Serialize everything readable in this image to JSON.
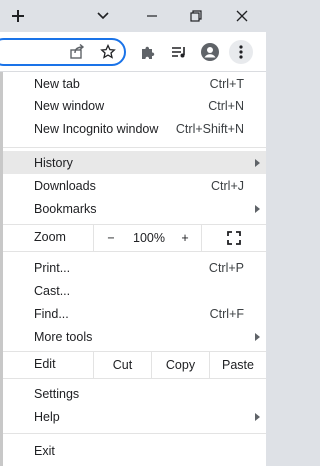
{
  "titlebar": {
    "new_tab_icon": "plus-icon",
    "tab_search_icon": "chevron-down-icon",
    "minimize_icon": "minimize-icon",
    "restore_icon": "restore-icon",
    "close_icon": "close-icon"
  },
  "toolbar": {
    "share_icon": "share-icon",
    "bookmark_icon": "star-icon",
    "extensions_icon": "puzzle-icon",
    "media_icon": "media-queue-icon",
    "profile_icon": "avatar-icon",
    "menu_icon": "kebab-menu-icon",
    "accent": "#1a73e8"
  },
  "menu": {
    "new_tab": {
      "label": "New tab",
      "accel": "Ctrl+T"
    },
    "new_window": {
      "label": "New window",
      "accel": "Ctrl+N"
    },
    "incognito": {
      "label": "New Incognito window",
      "accel": "Ctrl+Shift+N"
    },
    "history": {
      "label": "History"
    },
    "downloads": {
      "label": "Downloads",
      "accel": "Ctrl+J"
    },
    "bookmarks": {
      "label": "Bookmarks"
    },
    "zoom": {
      "label": "Zoom",
      "minus": "−",
      "value": "100%",
      "plus": "+",
      "fullscreen_icon": "fullscreen-icon"
    },
    "print": {
      "label": "Print...",
      "accel": "Ctrl+P"
    },
    "cast": {
      "label": "Cast..."
    },
    "find": {
      "label": "Find...",
      "accel": "Ctrl+F"
    },
    "more_tools": {
      "label": "More tools"
    },
    "edit": {
      "label": "Edit",
      "cut": "Cut",
      "copy": "Copy",
      "paste": "Paste"
    },
    "settings": {
      "label": "Settings"
    },
    "help": {
      "label": "Help"
    },
    "exit": {
      "label": "Exit"
    }
  }
}
